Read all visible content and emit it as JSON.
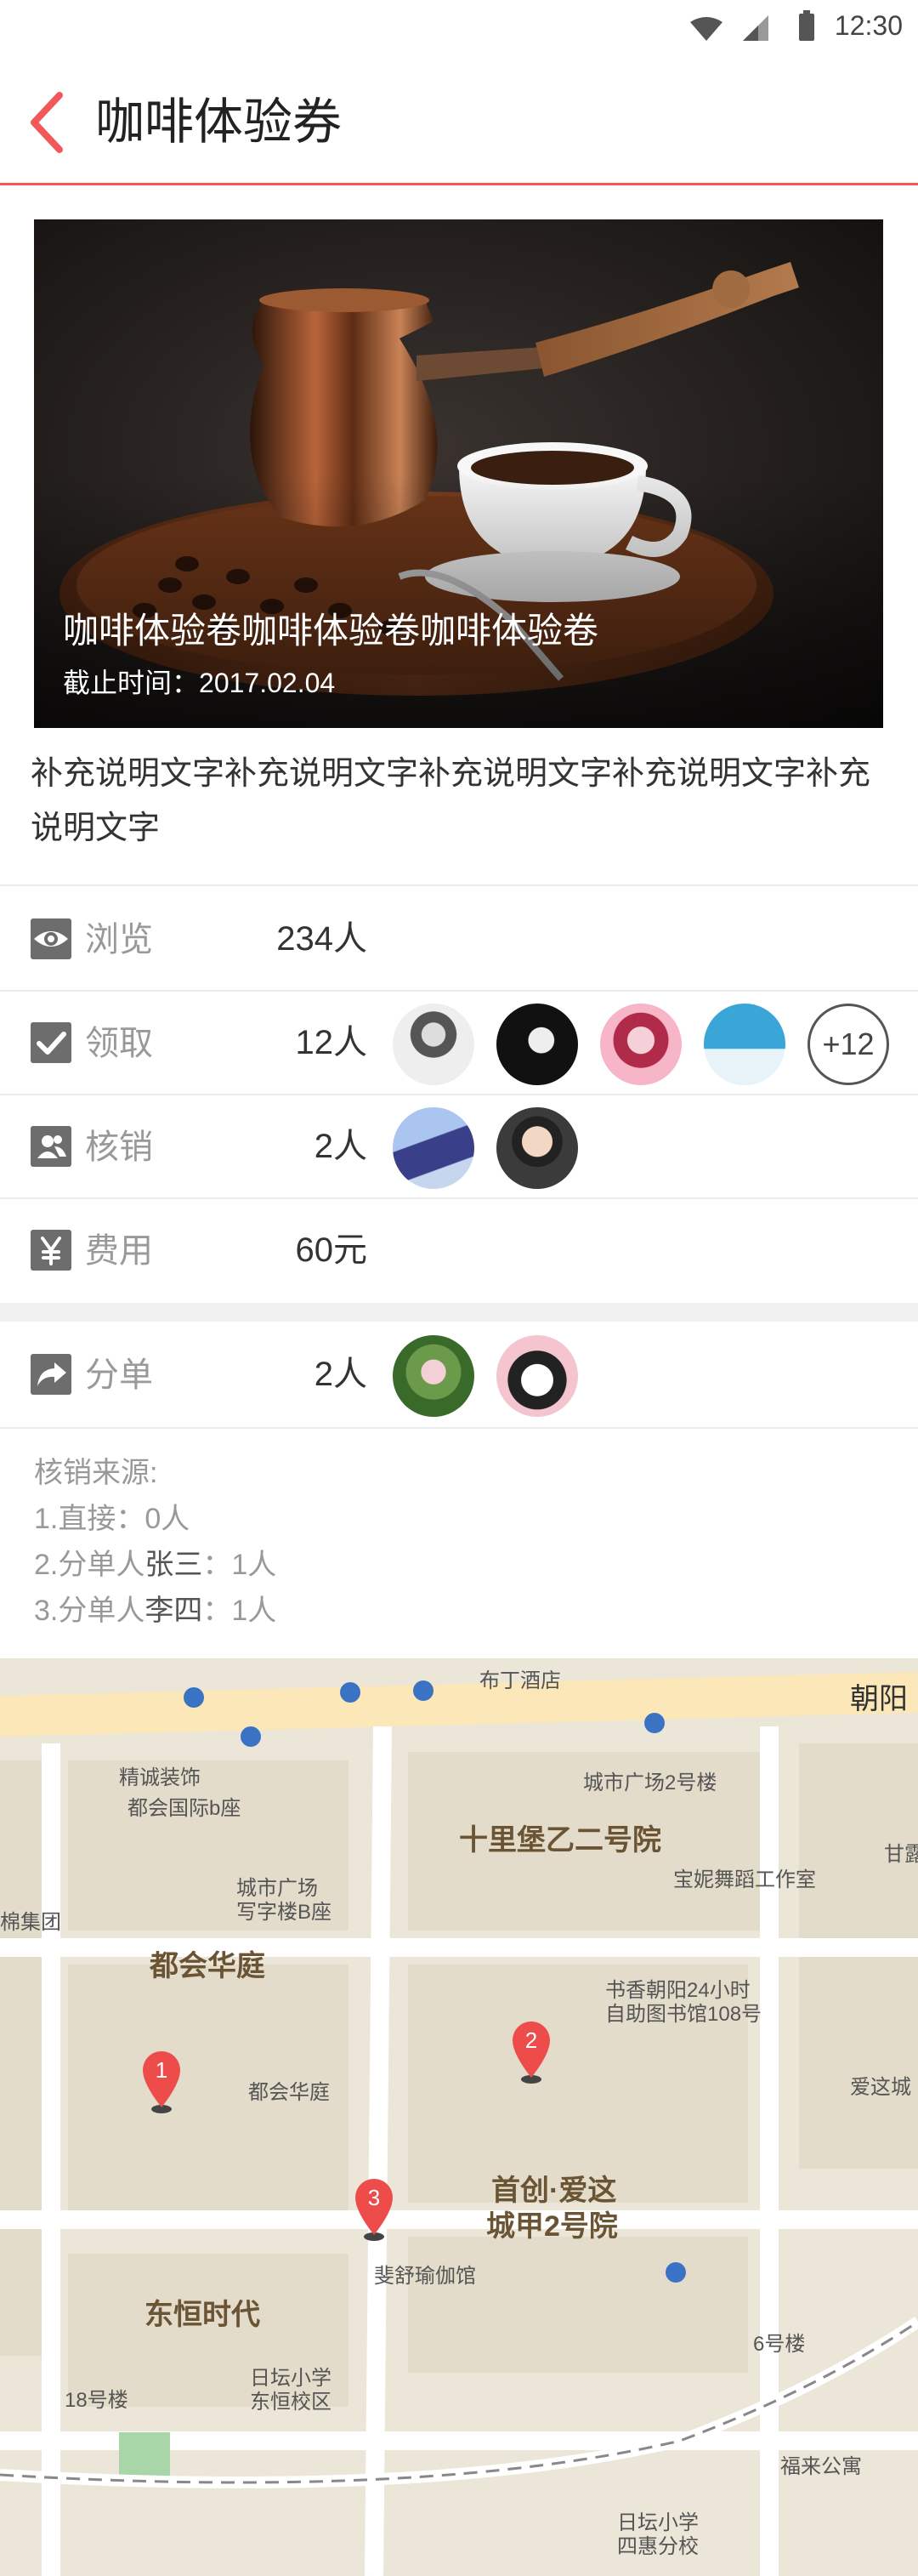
{
  "status_bar": {
    "time": "12:30"
  },
  "header": {
    "title": "咖啡体验券"
  },
  "coupon": {
    "name": "咖啡体验卷咖啡体验卷咖啡体验卷",
    "deadline_label": "截止时间：",
    "deadline_value": "2017.02.04",
    "description": "补充说明文字补充说明文字补充说明文字补充说明文字补充说明文字"
  },
  "stats": {
    "views": {
      "label": "浏览",
      "value": "234人",
      "icon": "eye-icon"
    },
    "received": {
      "label": "领取",
      "value": "12人",
      "icon": "checkbox-icon",
      "more": "+12"
    },
    "redeemed": {
      "label": "核销",
      "value": "2人",
      "icon": "users-icon"
    },
    "cost": {
      "label": "费用",
      "value": "60元",
      "icon": "yen-icon"
    },
    "shared": {
      "label": "分单",
      "value": "2人",
      "icon": "share-icon"
    }
  },
  "redeem_source": {
    "title": "核销来源:",
    "lines": [
      {
        "prefix": "1.直接：",
        "name": "",
        "count": "0人"
      },
      {
        "prefix": "2.分单人",
        "name": "张三",
        "count": "：1人"
      },
      {
        "prefix": "3.分单人",
        "name": "李四",
        "count": "：1人"
      }
    ]
  },
  "map": {
    "labels": [
      "布丁酒店",
      "朝阳",
      "精诚装饰",
      "都会国际b座",
      "城市广场2号楼",
      "十里堡乙二号院",
      "宝妮舞蹈工作室",
      "城市广场",
      "写字楼B座",
      "棉集团",
      "都会华庭",
      "书香朝阳24小时",
      "自助图书馆108号",
      "都会华庭",
      "爱这城",
      "首创·爱这",
      "城甲2号院",
      "斐舒瑜伽馆",
      "东恒时代",
      "6号楼",
      "18号楼",
      "日坛小学",
      "东恒校区",
      "福来公寓",
      "日坛小学",
      "四惠分校",
      "甘露"
    ],
    "markers": [
      "1",
      "2",
      "3"
    ]
  },
  "colors": {
    "accent": "#f2575a",
    "icon_gray": "#6d6d6d"
  }
}
